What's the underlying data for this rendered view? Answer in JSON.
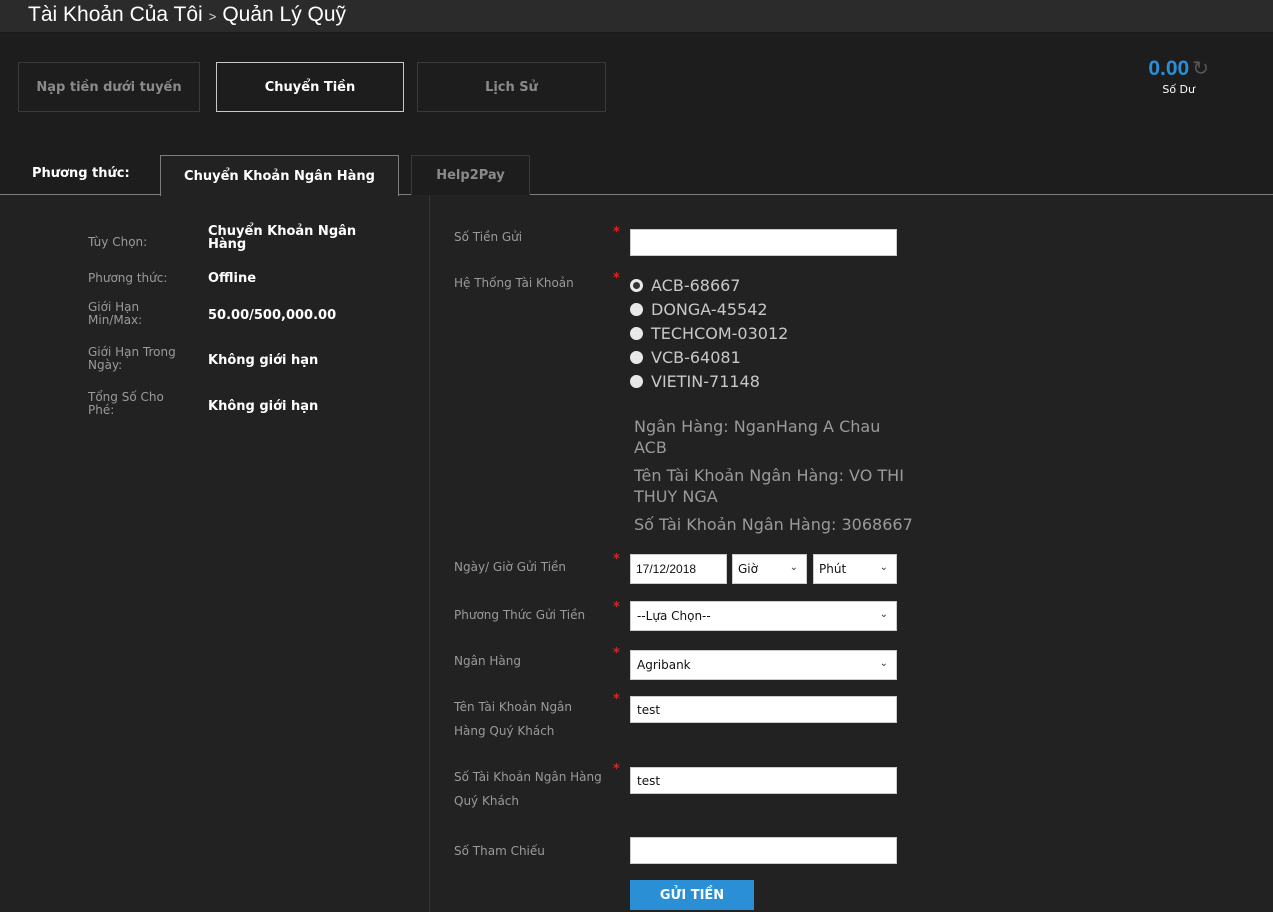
{
  "header": {
    "title_part1": "Tài Khoản Của Tôi",
    "separator": ">",
    "title_part2": "Quản Lý Quỹ"
  },
  "topnav": {
    "items": [
      {
        "label": "Nạp tiền dưới tuyến",
        "active": false
      },
      {
        "label": "Chuyển Tiền",
        "active": true
      },
      {
        "label": "Lịch Sử",
        "active": false
      }
    ]
  },
  "balance": {
    "amount": "0.00",
    "label": "Số Dư",
    "refresh_icon": "↻"
  },
  "method": {
    "label": "Phương thức:",
    "tabs": [
      {
        "label": "Chuyển Khoản Ngân Hàng",
        "active": true
      },
      {
        "label": "Help2Pay",
        "active": false
      }
    ]
  },
  "info": [
    {
      "label": "Tùy Chọn:",
      "value": "Chuyển Khoản Ngân Hàng"
    },
    {
      "label": "Phương thức:",
      "value": "Offline"
    },
    {
      "label": "Giới Hạn Min/Max:",
      "value": "50.00/500,000.00"
    },
    {
      "label": "Giới Hạn Trong Ngày:",
      "value": "Không giới hạn"
    },
    {
      "label": "Tổng Số Cho Phé:",
      "value": "Không giới hạn"
    }
  ],
  "form": {
    "required_mark": "*",
    "amount": {
      "label": "Số Tiền Gửi",
      "value": ""
    },
    "account_system": {
      "label": "Hệ Thống Tài Khoản",
      "options": [
        {
          "label": "ACB-68667",
          "checked": true
        },
        {
          "label": "DONGA-45542",
          "checked": false
        },
        {
          "label": "TECHCOM-03012",
          "checked": false
        },
        {
          "label": "VCB-64081",
          "checked": false
        },
        {
          "label": "VIETIN-71148",
          "checked": false
        }
      ]
    },
    "bank_info": {
      "bank": "Ngân Hàng: NganHang A Chau ACB",
      "account_name": "Tên Tài Khoản Ngân Hàng: VO THI THUY NGA",
      "account_number": "Số Tài Khoản Ngân Hàng: 3068667"
    },
    "deposit_datetime": {
      "label": "Ngày/ Giờ Gửi Tiền",
      "date": "17/12/2018",
      "hour": "Giờ",
      "minute": "Phút"
    },
    "deposit_method": {
      "label": "Phương Thức Gửi Tiền",
      "value": "--Lựa Chọn--"
    },
    "bank": {
      "label": "Ngân Hàng",
      "value": "Agribank"
    },
    "customer_account_name": {
      "label": "Tên Tài Khoản Ngân Hàng Quý Khách",
      "value": "test"
    },
    "customer_account_number": {
      "label": "Số Tài Khoản Ngân Hàng Quý Khách",
      "value": "test"
    },
    "reference": {
      "label": "Số Tham Chiếu",
      "value": ""
    },
    "submit_label": "GỬI TIỀN"
  }
}
